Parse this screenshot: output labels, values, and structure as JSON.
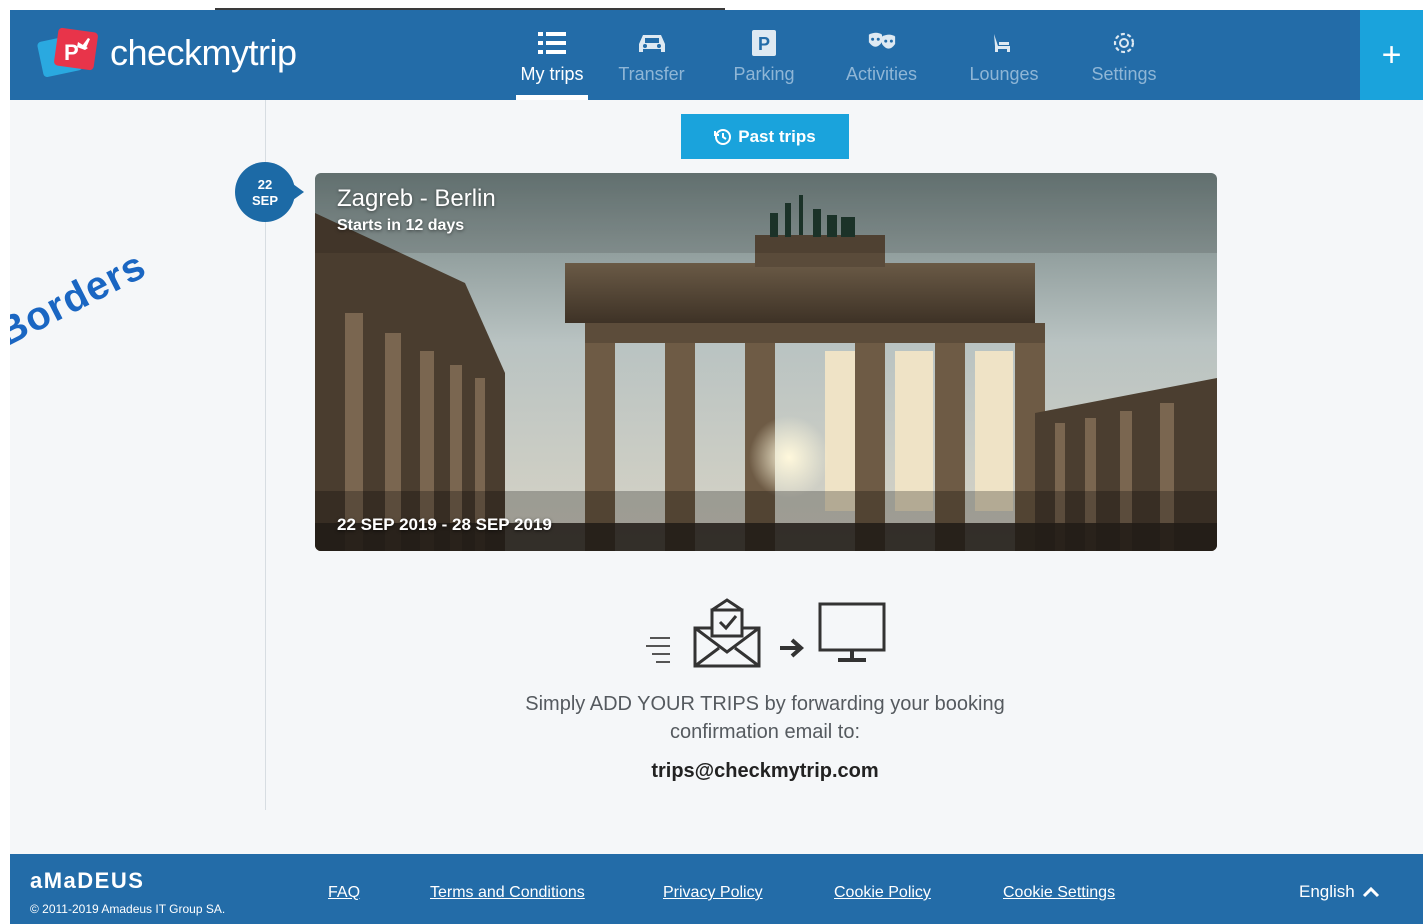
{
  "app": {
    "logo_text": "checkmytrip"
  },
  "nav": {
    "items": [
      {
        "label": "My trips",
        "icon": "list-icon",
        "active": true
      },
      {
        "label": "Transfer",
        "icon": "car-icon",
        "active": false
      },
      {
        "label": "Parking",
        "icon": "parking-icon",
        "active": false
      },
      {
        "label": "Activities",
        "icon": "masks-icon",
        "active": false
      },
      {
        "label": "Lounges",
        "icon": "lounge-chair-icon",
        "active": false
      },
      {
        "label": "Settings",
        "icon": "gear-icon",
        "active": false
      }
    ],
    "add_label": "+"
  },
  "timeline": {
    "past_trips_label": "Past trips",
    "badge_day": "22",
    "badge_month": "SEP"
  },
  "trip": {
    "title": "Zagreb - Berlin",
    "subtitle": "Starts in 12 days",
    "dates": "22 SEP 2019 - 28 SEP 2019"
  },
  "instructions": {
    "line1": "Simply ADD YOUR TRIPS by forwarding your booking",
    "line2": "confirmation email to:",
    "email": "trips@checkmytrip.com"
  },
  "watermark": "Borders",
  "footer": {
    "brand": "aMaDEUS",
    "copyright": "© 2011-2019 Amadeus IT Group SA.",
    "links": [
      "FAQ",
      "Terms and Conditions",
      "Privacy Policy",
      "Cookie Policy",
      "Cookie Settings"
    ],
    "language": "English"
  },
  "colors": {
    "header": "#236ca8",
    "accent": "#1aa3dc",
    "badge": "#1c6aa6",
    "background": "#f5f7f9"
  }
}
